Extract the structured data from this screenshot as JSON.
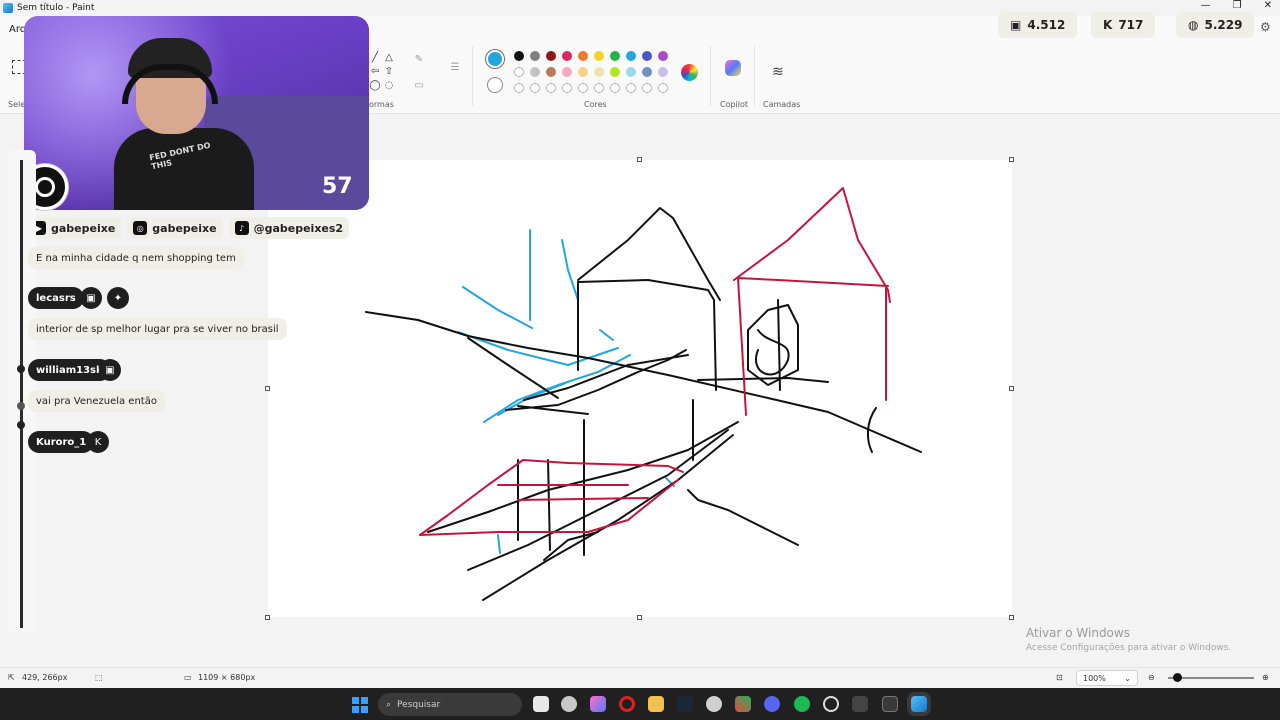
{
  "window": {
    "title": "Sem título - Paint",
    "controls": [
      "—",
      "❐",
      "✕"
    ]
  },
  "ribbon": {
    "menu_file": "Arq",
    "groups": {
      "selection": "Sele",
      "shapes": "ormas",
      "colors": "Cores",
      "copilot": "Copilot",
      "layers": "Camadas"
    },
    "primary_color": "#22a6de",
    "swatches_row1": [
      "#111111",
      "#7f7f7f",
      "#8b1a1a",
      "#e0245e",
      "#f07a2b",
      "#f5d327",
      "#24b24b",
      "#22a6de",
      "#4a56c9",
      "#a64ac9"
    ],
    "swatches_row2": [
      "#ffffff",
      "#c3c3c3",
      "#b97a57",
      "#f7a8c4",
      "#f8d18a",
      "#efe4b0",
      "#b5e61d",
      "#99d9ea",
      "#7092be",
      "#c8bfe7"
    ]
  },
  "stream": {
    "counters": [
      {
        "icon": "twitch-icon",
        "glyph": "▣",
        "value": "4.512"
      },
      {
        "icon": "kick-icon",
        "glyph": "K",
        "value": "717"
      },
      {
        "icon": "globe-icon",
        "glyph": "◍",
        "value": "5.229"
      }
    ],
    "cam_number": "57",
    "shirt_text": "FED DONT DO THIS",
    "socials": [
      {
        "icon": "youtube-icon",
        "glyph": "▶",
        "label": "gabepeixe"
      },
      {
        "icon": "instagram-icon",
        "glyph": "◎",
        "label": "gabepeixe"
      },
      {
        "icon": "tiktok-icon",
        "glyph": "♪",
        "label": "@gabepeixes2"
      }
    ],
    "chat": [
      {
        "type": "message",
        "text": "E na minha cidade q nem shopping tem"
      },
      {
        "type": "user",
        "name": "lecasrs"
      },
      {
        "type": "message",
        "text": "interior de sp melhor lugar pra se viver no brasil"
      },
      {
        "type": "user",
        "name": "william13sk"
      },
      {
        "type": "message",
        "text": "vai pra Venezuela então"
      },
      {
        "type": "user",
        "name": "Kuroro_1"
      }
    ]
  },
  "canvas": {
    "size_label": "1109 × 680px"
  },
  "status": {
    "cursor_pos": "429, 266px",
    "selection_size": "1109 × 680px",
    "zoom": "100%",
    "zoom_fraction": 0.1
  },
  "watermark": {
    "title": "Ativar o Windows",
    "subtitle": "Acesse Configurações para ativar o Windows."
  },
  "taskbar": {
    "search_placeholder": "Pesquisar"
  }
}
